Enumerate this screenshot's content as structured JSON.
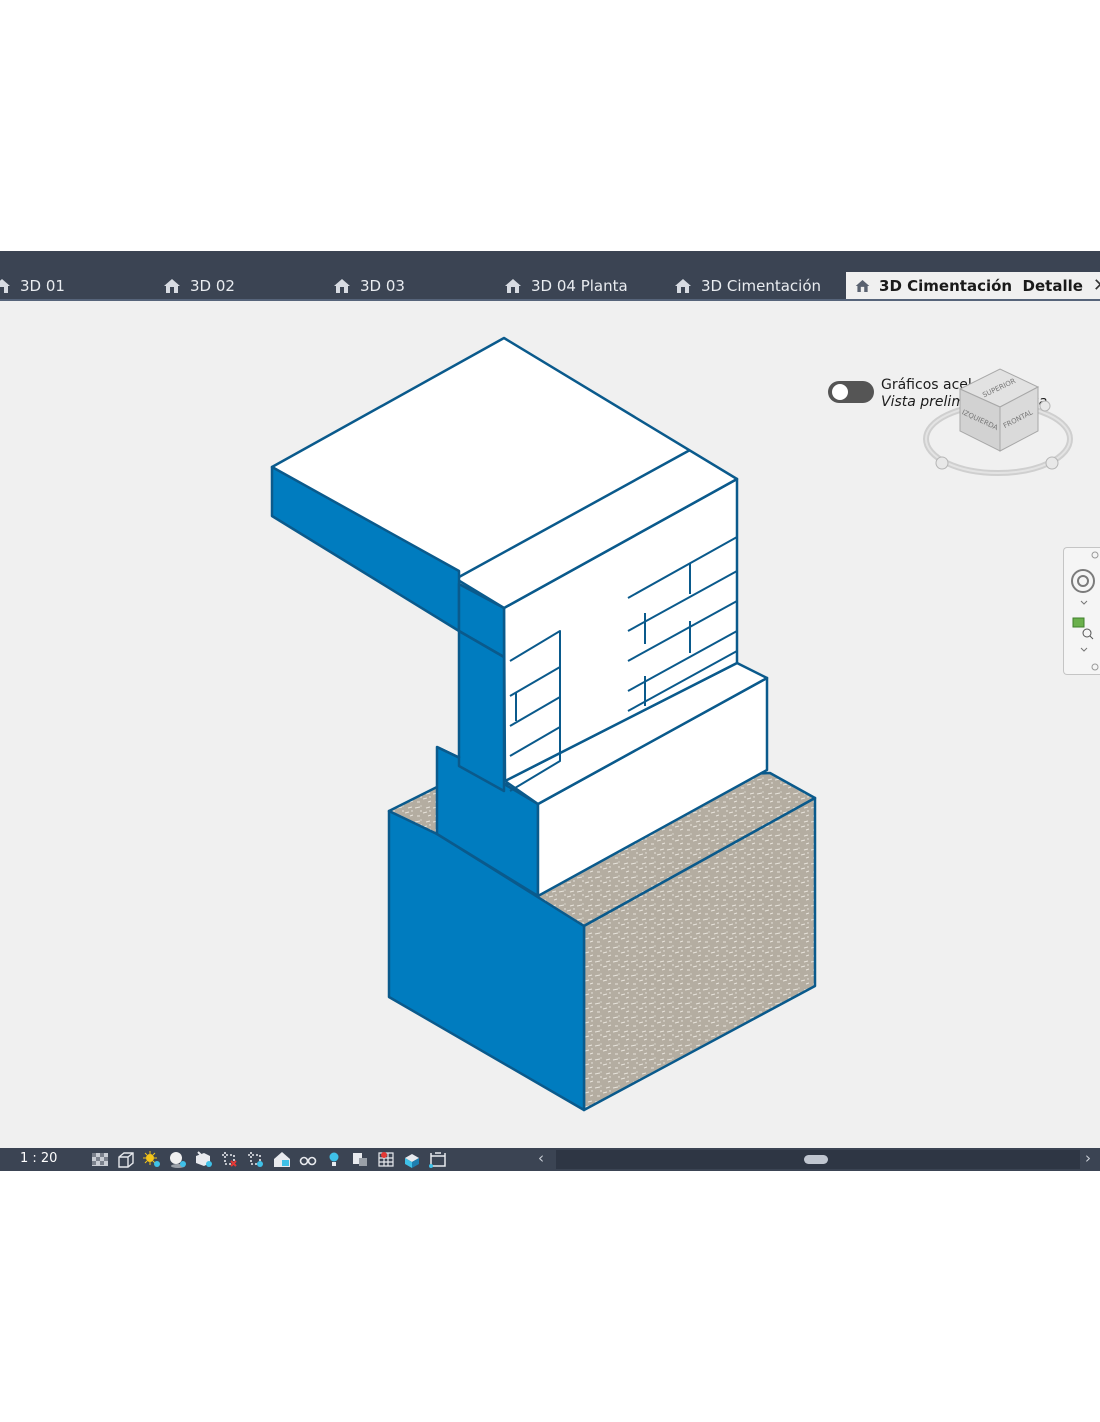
{
  "tabs": [
    {
      "label": "3D 01"
    },
    {
      "label": "3D 02"
    },
    {
      "label": "3D 03"
    },
    {
      "label": "3D 04 Planta"
    },
    {
      "label": "3D Cimentación"
    },
    {
      "label": "3D Cimentación  Detalle",
      "active": true
    }
  ],
  "close_symbol": "✕",
  "toggle": {
    "line1": "Gráficos acelerados",
    "line2": "Vista preliminar técnica",
    "on": false
  },
  "viewcube": {
    "top": "SUPERIOR",
    "left": "IZQUIERDA",
    "front": "FRONTAL"
  },
  "status": {
    "scale": "1 : 20",
    "icons": [
      "detail-level-icon",
      "visual-style-icon",
      "sun-path-icon",
      "shadows-icon",
      "render-icon",
      "crop-view-icon",
      "crop-region-icon",
      "unlock-3d-icon",
      "temporary-hide-icon",
      "reveal-hidden-icon",
      "worksharing-icon",
      "display-constraints-icon",
      "analytical-model-icon",
      "highlight-displacement-icon",
      "section-box-icon"
    ]
  },
  "colors": {
    "accent_blue": "#007cbf",
    "outline_blue": "#0a5a8c",
    "soil": "#b4ada1",
    "ui_dark": "#3b4453"
  }
}
